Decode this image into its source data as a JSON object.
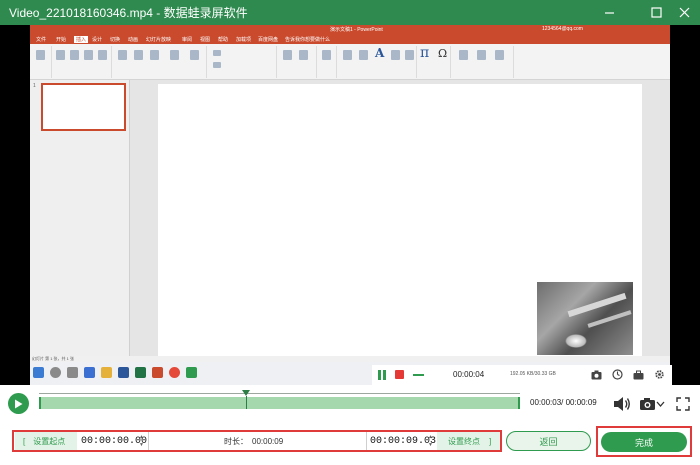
{
  "window": {
    "title": "Video_221018160346.mp4  -  数据蛙录屏软件",
    "minimize_glyph": "–",
    "maximize_glyph": "☐",
    "close_glyph": "✕"
  },
  "ppt": {
    "title": "演示文稿1  -  PowerPoint",
    "account": "1234564@qq.com",
    "menu": [
      "文件",
      "开始",
      "插入",
      "设计",
      "切换",
      "动画",
      "幻灯片放映",
      "审阅",
      "视图",
      "帮助",
      "加载项",
      "百度网盘",
      "告诉我你想要做什么"
    ],
    "slide_number": "1",
    "status": "幻灯片 第 1 张，共 1 张"
  },
  "recording": {
    "elapsed": "00:00:04",
    "file_size": "192.05 KB/30.33 GB"
  },
  "timeline": {
    "current": "00:00:03",
    "total": "00:00:09",
    "separator": "/ ",
    "progress_fraction": 0.43
  },
  "trim": {
    "set_start_label": "设置起点",
    "start_time": "00:00:00.00",
    "duration_label": "时长：",
    "duration_value": "00:00:09",
    "end_time": "00:00:09.03",
    "set_end_label": "设置终点",
    "left_bracket": "[",
    "right_bracket": "]"
  },
  "buttons": {
    "back": "返回",
    "done": "完成"
  },
  "icons": {
    "play": "play-icon",
    "volume": "volume-icon",
    "camera": "camera-icon",
    "expand": "expand-icon"
  },
  "colors": {
    "primary_green": "#2e9b4e",
    "title_bar": "#2f8a4f",
    "highlight_red": "#e03b3b",
    "ppt_red": "#c94a2d"
  }
}
